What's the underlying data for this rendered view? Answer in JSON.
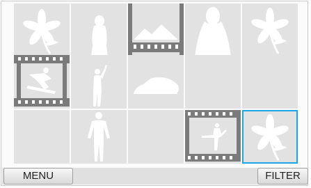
{
  "bottom_bar": {
    "menu_label": "MENU",
    "filter_label": "FILTER"
  },
  "accent_color": "#1aa6e6",
  "thumbnails": [
    {
      "icon": "flower-icon",
      "kind": "photo",
      "selected": false
    },
    {
      "icon": "person-silhouette-icon",
      "kind": "photo",
      "selected": false
    },
    {
      "icon": "mountain-landscape-icon",
      "kind": "video",
      "selected": false
    },
    {
      "icon": "person-silhouette-icon",
      "kind": "photo",
      "selected": false
    },
    {
      "icon": "flower-icon",
      "kind": "photo",
      "selected": false
    },
    {
      "icon": "snowboarder-icon",
      "kind": "video",
      "selected": false
    },
    {
      "icon": "person-pointing-icon",
      "kind": "photo",
      "selected": false
    },
    {
      "icon": "car-icon",
      "kind": "photo",
      "selected": false
    },
    {
      "icon": "blank-icon",
      "kind": "photo",
      "selected": false
    },
    {
      "icon": "blank-icon",
      "kind": "photo",
      "selected": false
    },
    {
      "icon": "blank-icon",
      "kind": "photo",
      "selected": false
    },
    {
      "icon": "standing-person-icon",
      "kind": "photo",
      "selected": false
    },
    {
      "icon": "blank-icon",
      "kind": "photo",
      "selected": false
    },
    {
      "icon": "ballerina-icon",
      "kind": "video",
      "selected": false
    },
    {
      "icon": "flower-icon",
      "kind": "photo",
      "selected": true
    }
  ]
}
